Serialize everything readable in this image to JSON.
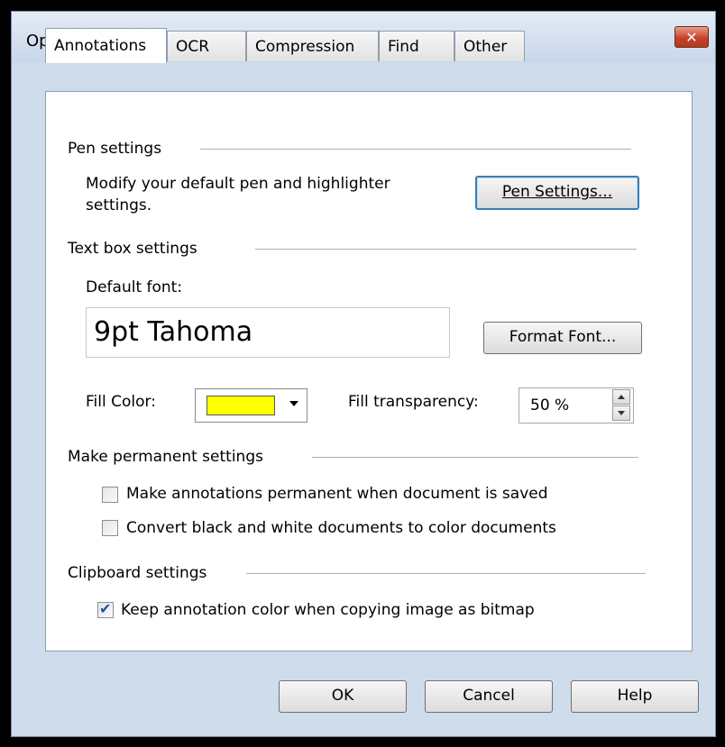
{
  "window": {
    "title": "Options"
  },
  "tabs": [
    "Annotations",
    "OCR",
    "Compression",
    "Find",
    "Other"
  ],
  "sections": {
    "pen": {
      "title": "Pen settings",
      "description_line1": "Modify your default pen and highlighter",
      "description_line2": "settings.",
      "button": "Pen Settings..."
    },
    "textbox": {
      "title": "Text box settings",
      "default_font_label": "Default font:",
      "default_font_value": "9pt Tahoma",
      "format_font_button": "Format Font...",
      "fill_color_label": "Fill Color:",
      "fill_color": "#ffff00",
      "fill_transparency_label": "Fill transparency:",
      "fill_transparency_value": "50 %"
    },
    "permanent": {
      "title": "Make permanent settings",
      "options": [
        {
          "label": "Make annotations permanent when document is saved",
          "checked": false
        },
        {
          "label": "Convert black and white documents to color documents",
          "checked": false
        }
      ]
    },
    "clipboard": {
      "title": "Clipboard settings",
      "options": [
        {
          "label": "Keep annotation color when copying image as bitmap",
          "checked": true
        }
      ]
    }
  },
  "footer": {
    "ok": "OK",
    "cancel": "Cancel",
    "help": "Help"
  }
}
